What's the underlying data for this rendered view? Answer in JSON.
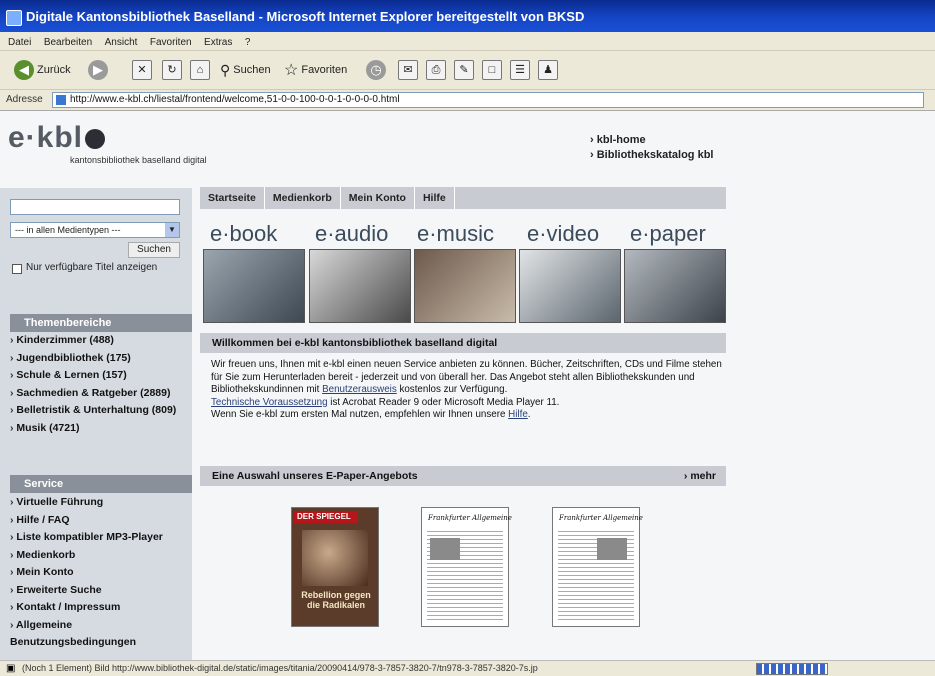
{
  "window": {
    "title": "Digitale Kantonsbibliothek Baselland - Microsoft Internet Explorer bereitgestellt von BKSD"
  },
  "menubar": [
    "Datei",
    "Bearbeiten",
    "Ansicht",
    "Favoriten",
    "Extras",
    "?"
  ],
  "toolbar": {
    "back": "Zurück",
    "search": "Suchen",
    "favorites": "Favoriten"
  },
  "address": {
    "label": "Adresse",
    "url": "http://www.e-kbl.ch/liestal/frontend/welcome,51-0-0-100-0-0-1-0-0-0-0.html"
  },
  "site": {
    "logo": "e·kbl",
    "logo_sub": "kantonsbibliothek baselland digital",
    "top_links": [
      "kbl-home",
      "Bibliothekskatalog kbl"
    ]
  },
  "search": {
    "select_value": "--- in allen Medientypen ---",
    "button": "Suchen",
    "checkbox_label": "Nur verfügbare Titel anzeigen"
  },
  "themen": {
    "heading": "Themenbereiche",
    "items": [
      "Kinderzimmer (488)",
      "Jugendbibliothek (175)",
      "Schule & Lernen (157)",
      "Sachmedien & Ratgeber (2889)",
      "Belletristik & Unterhaltung (809)",
      "Musik (4721)"
    ]
  },
  "service": {
    "heading": "Service",
    "items": [
      "Virtuelle Führung",
      "Hilfe / FAQ",
      "Liste kompatibler MP3-Player",
      "Medienkorb",
      "Mein Konto",
      "Erweiterte Suche",
      "Kontakt / Impressum",
      "Allgemeine Benutzungsbedingungen"
    ]
  },
  "nav": [
    "Startseite",
    "Medienkorb",
    "Mein Konto",
    "Hilfe"
  ],
  "brands": [
    "e·book",
    "e·audio",
    "e·music",
    "e·video",
    "e·paper"
  ],
  "welcome": {
    "heading": "Willkommen bei e-kbl kantonsbibliothek baselland digital",
    "p1": "Wir freuen uns, Ihnen mit e-kbl einen neuen Service anbieten zu können. Bücher, Zeitschriften, CDs und Filme stehen für Sie zum Herunterladen bereit - jederzeit und von überall her. Das Angebot steht allen Bibliothekskunden und Bibliothekskundinnen mit",
    "link_ausweis": "Benutzerausweis",
    "p1_end": "kostenlos zur Verfügung.",
    "link_tech": "Technische Voraussetzung",
    "p2": "ist Acrobat Reader 9 oder Microsoft Media Player 11.",
    "p3": "Wenn Sie e-kbl zum ersten Mal nutzen, empfehlen wir Ihnen unsere",
    "link_hilfe": "Hilfe",
    "p3_end": "."
  },
  "epaper": {
    "heading": "Eine Auswahl unseres E-Paper-Angebots",
    "more": "› mehr",
    "covers": [
      {
        "masthead": "DER SPIEGEL",
        "headline": "Rebellion gegen die Radikalen"
      },
      {
        "masthead": "Frankfurter Allgemeine"
      },
      {
        "masthead": "Frankfurter Allgemeine"
      }
    ]
  },
  "status": {
    "text": "(Noch 1 Element) Bild http://www.bibliothek-digital.de/static/images/titania/20090414/978-3-7857-3820-7/tn978-3-7857-3820-7s.jp"
  }
}
